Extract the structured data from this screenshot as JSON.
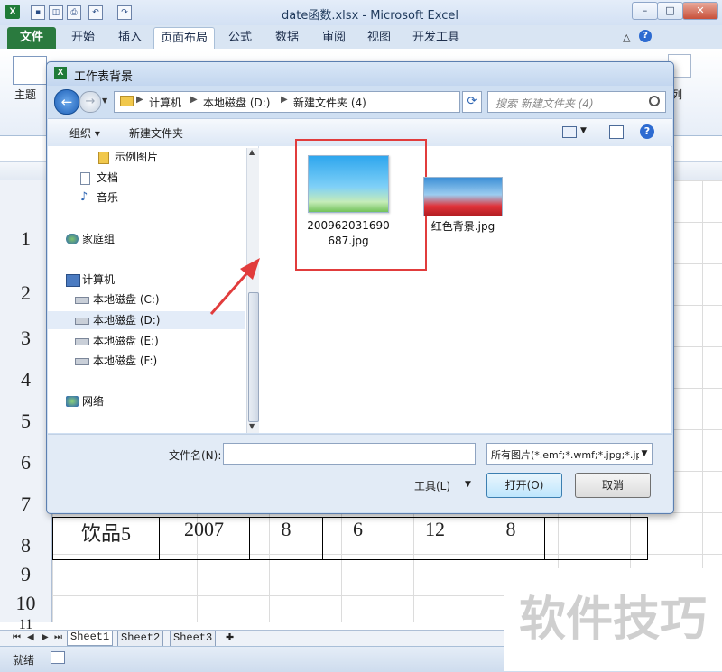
{
  "window": {
    "app_icon": "X",
    "title": "date函数.xlsx - Microsoft Excel",
    "controls": {
      "minimize": "–",
      "maximize": "□",
      "close": "✕"
    }
  },
  "ribbon": {
    "tabs": [
      {
        "label": "文件"
      },
      {
        "label": "开始"
      },
      {
        "label": "插入"
      },
      {
        "label": "页面布局"
      },
      {
        "label": "公式"
      },
      {
        "label": "数据"
      },
      {
        "label": "审阅"
      },
      {
        "label": "视图"
      },
      {
        "label": "开发工具"
      }
    ],
    "active_tab": "页面布局",
    "theme_group_label": "主题",
    "right_group_label": "列"
  },
  "sheet": {
    "row_numbers": [
      "1",
      "2",
      "3",
      "4",
      "5",
      "6",
      "7",
      "8",
      "9",
      "10",
      "11"
    ],
    "row8_cells": [
      "饮品5",
      "2007",
      "8",
      "6",
      "12",
      "8",
      ""
    ],
    "tabs": [
      "Sheet1",
      "Sheet2",
      "Sheet3"
    ],
    "status": "就绪"
  },
  "dialog": {
    "title": "工作表背景",
    "breadcrumbs": [
      "计算机",
      "本地磁盘 (D:)",
      "新建文件夹 (4)"
    ],
    "search_placeholder": "搜索 新建文件夹 (4)",
    "toolbar": {
      "organize": "组织 ▾",
      "new_folder": "新建文件夹"
    },
    "nav_items": [
      {
        "label": "示例图片",
        "icon": "folder-icon"
      },
      {
        "label": "文档",
        "icon": "document-icon"
      },
      {
        "label": "音乐",
        "icon": "music-icon"
      },
      {
        "label": "家庭组",
        "icon": "homegroup-icon"
      },
      {
        "label": "计算机",
        "icon": "computer-icon"
      },
      {
        "label": "本地磁盘 (C:)",
        "icon": "drive-icon"
      },
      {
        "label": "本地磁盘 (D:)",
        "icon": "drive-icon",
        "selected": true
      },
      {
        "label": "本地磁盘 (E:)",
        "icon": "drive-icon"
      },
      {
        "label": "本地磁盘 (F:)",
        "icon": "drive-icon"
      },
      {
        "label": "网络",
        "icon": "network-icon"
      }
    ],
    "files": [
      {
        "name_line1": "200962031690",
        "name_line2": "687.jpg",
        "highlighted": true
      },
      {
        "name": "红色背景.jpg"
      }
    ],
    "filename_label": "文件名(N):",
    "filename_value": "",
    "filetype": "所有图片(*.emf;*.wmf;*.jpg;*.jp",
    "tools_label": "工具(L)",
    "open_label": "打开(O)",
    "cancel_label": "取消"
  },
  "watermark": "软件技巧",
  "colors": {
    "highlight": "#e13c3c",
    "excel_green": "#2a7a3e",
    "dialog_bg": "#cfdff2"
  }
}
